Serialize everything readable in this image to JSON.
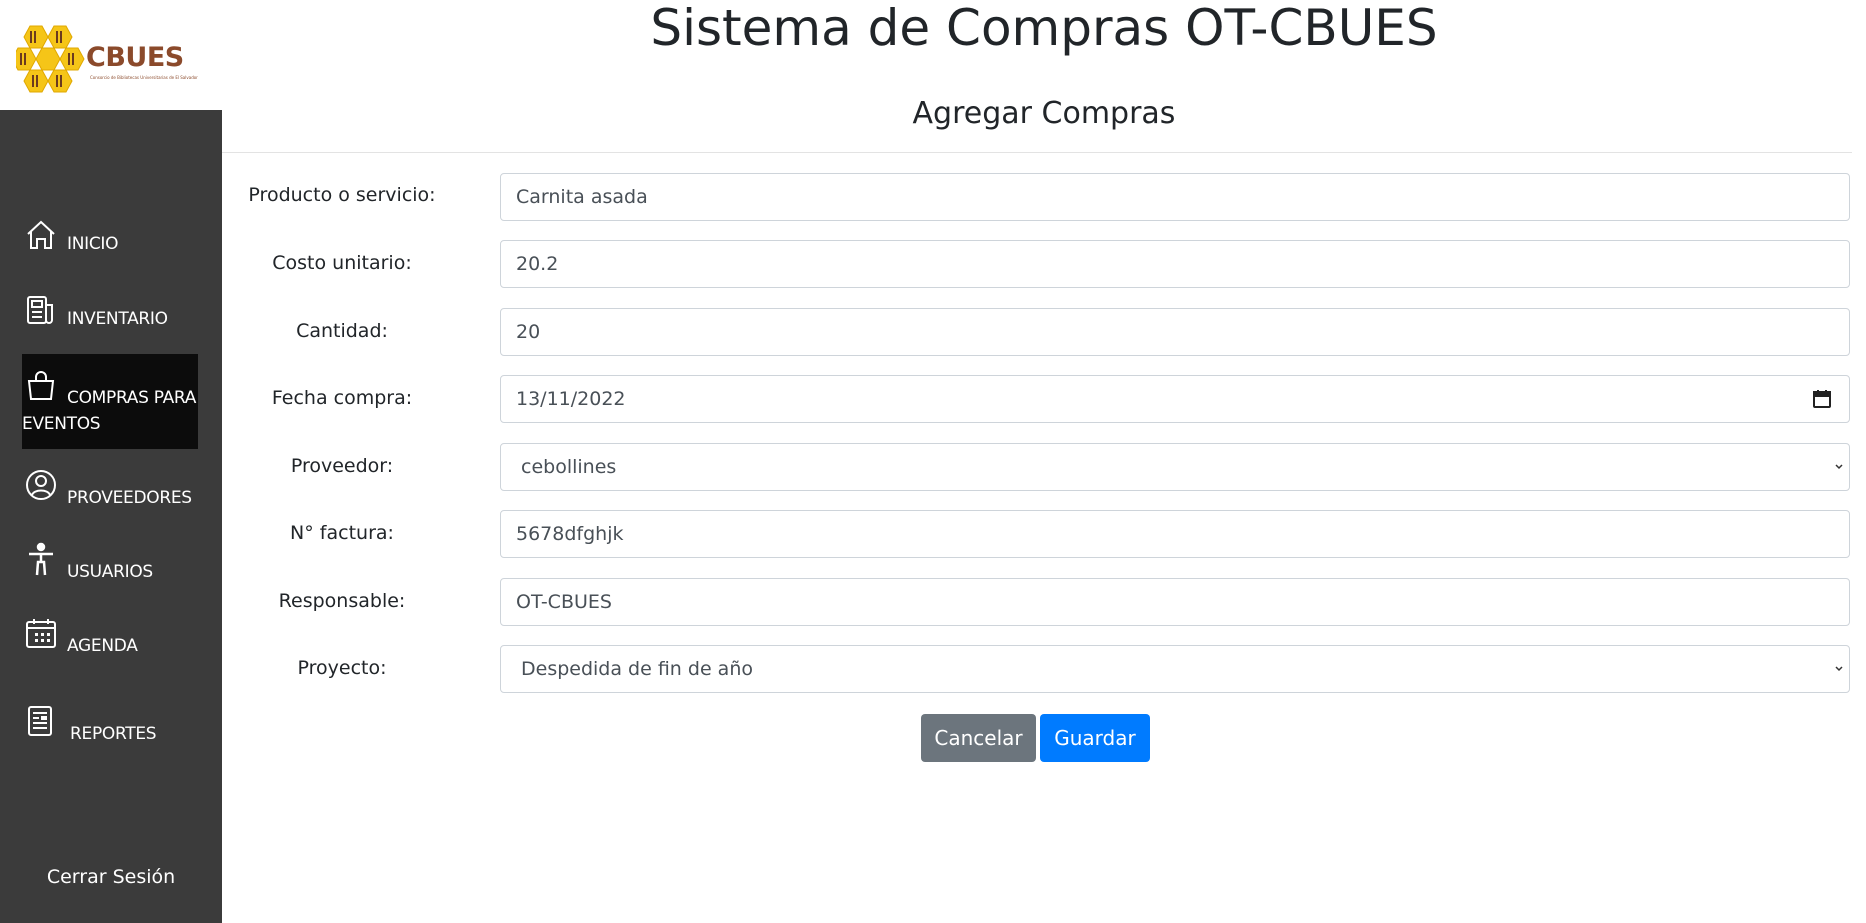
{
  "logo": {
    "text": "CBUES",
    "subtext": "Consorcio de Bibliotecas Universitarias de El Salvador"
  },
  "header": {
    "title": "Sistema de Compras OT-CBUES",
    "subtitle": "Agregar Compras"
  },
  "sidebar": {
    "items": [
      {
        "label": "INICIO",
        "icon": "home-icon"
      },
      {
        "label": "INVENTARIO",
        "icon": "newspaper-icon"
      },
      {
        "label": "COMPRAS PARA",
        "label2": "EVENTOS",
        "icon": "shopping-bag-icon",
        "active": true
      },
      {
        "label": "PROVEEDORES",
        "icon": "user-circle-icon"
      },
      {
        "label": "USUARIOS",
        "icon": "person-icon"
      },
      {
        "label": "AGENDA",
        "icon": "calendar-icon"
      },
      {
        "label": "REPORTES",
        "icon": "report-icon"
      }
    ],
    "logout": "Cerrar Sesión"
  },
  "form": {
    "producto": {
      "label": "Producto o servicio:",
      "value": "Carnita asada"
    },
    "costo": {
      "label": "Costo unitario:",
      "value": "20.2"
    },
    "cantidad": {
      "label": "Cantidad:",
      "value": "20"
    },
    "fecha": {
      "label": "Fecha compra:",
      "value": "13/11/2022"
    },
    "proveedor": {
      "label": "Proveedor:",
      "value": "cebollines"
    },
    "factura": {
      "label": "N° factura:",
      "value": "5678dfghjk"
    },
    "responsable": {
      "label": "Responsable:",
      "value": "OT-CBUES"
    },
    "proyecto": {
      "label": "Proyecto:",
      "value": "Despedida de fin de año"
    }
  },
  "buttons": {
    "cancel": "Cancelar",
    "save": "Guardar"
  },
  "colors": {
    "sidebar": "#3b3b3b",
    "active": "#0c0c0c",
    "primary": "#007bff",
    "secondary": "#6c757d",
    "logo": "#8b4a2b",
    "honey": "#f5c518"
  }
}
